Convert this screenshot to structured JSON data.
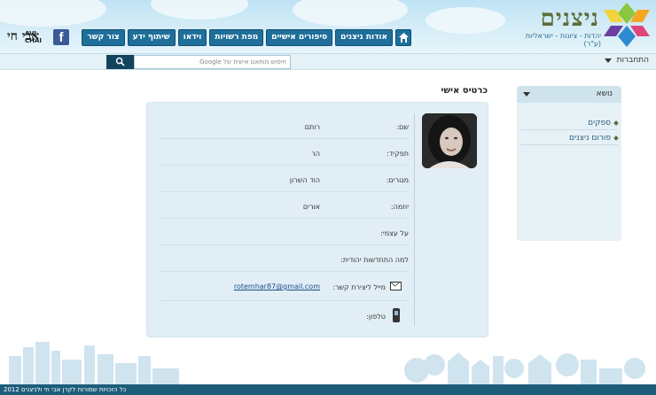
{
  "header": {
    "logo_text": "ניצנים",
    "logo_tagline": "יהדות - ציונות - ישראליות (ע\"ר)",
    "home_icon": "home-icon",
    "nav": [
      "אודות ניצנים",
      "סיפורים אישיים",
      "מפת רשויות",
      "וידאו",
      "שיתוף ידע",
      "צור קשר"
    ],
    "facebook_icon": "f",
    "partner_logo": {
      "hebrew": "אבי חי",
      "english_line1": "AVI",
      "english_line2": "CHAI"
    }
  },
  "searchbar": {
    "placeholder": "חיפוש מותאם אישית של Google",
    "google_mark": "Google™",
    "button_icon": "search-icon",
    "connect_label": "התחברות"
  },
  "sidebar": {
    "header": "נושא",
    "items": [
      "ספקים",
      "פורום ניצנים"
    ]
  },
  "main": {
    "title": "כרטיס אישי",
    "fields": [
      {
        "label": "שם:",
        "value": "רותם"
      },
      {
        "label": "תפקיד:",
        "value": "הר"
      },
      {
        "label": "מגורים:",
        "value": "הוד השרון"
      },
      {
        "label": "יוזמה:",
        "value": "אורים"
      },
      {
        "label": "על עצמי:",
        "value": ""
      },
      {
        "label": "למה התחדשות יהודית:",
        "value": ""
      }
    ],
    "email_label": "מייל ליצירת קשר:",
    "email_value": "rotemhar87@gmail.com",
    "phone_label": "טלפון:",
    "phone_value": ""
  },
  "footer": {
    "text": "כל הזכויות שמורות לקרן אבי חי ולניצנים 2012"
  },
  "colors": {
    "nav_button": "#1f6f9a",
    "footer": "#1d5d7a",
    "card": "#e1eef5",
    "logo_text": "#5f6b37"
  }
}
